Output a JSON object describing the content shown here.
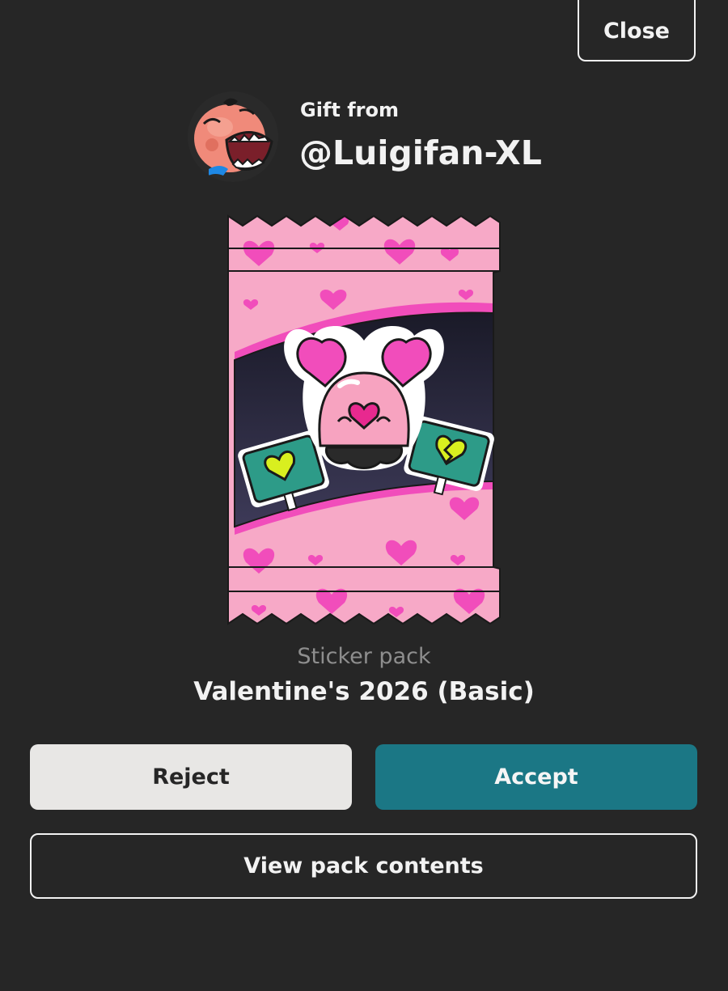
{
  "header": {
    "close_label": "Close"
  },
  "sender": {
    "gift_label": "Gift from",
    "username": "@Luigifan-XL",
    "avatar_icon": "avatar-laughing-character"
  },
  "pack": {
    "type_label": "Sticker pack",
    "name": "Valentine's 2026 (Basic)",
    "image_icon": "sticker-pack-wrapper",
    "colors": {
      "wrapper": "#f7a9c7",
      "hearts": "#f14dbb",
      "window": "#1f1f2e"
    }
  },
  "actions": {
    "reject_label": "Reject",
    "accept_label": "Accept",
    "view_contents_label": "View pack contents"
  },
  "colors": {
    "background": "#262626",
    "accept": "#1b7785",
    "reject": "#e8e7e5"
  }
}
